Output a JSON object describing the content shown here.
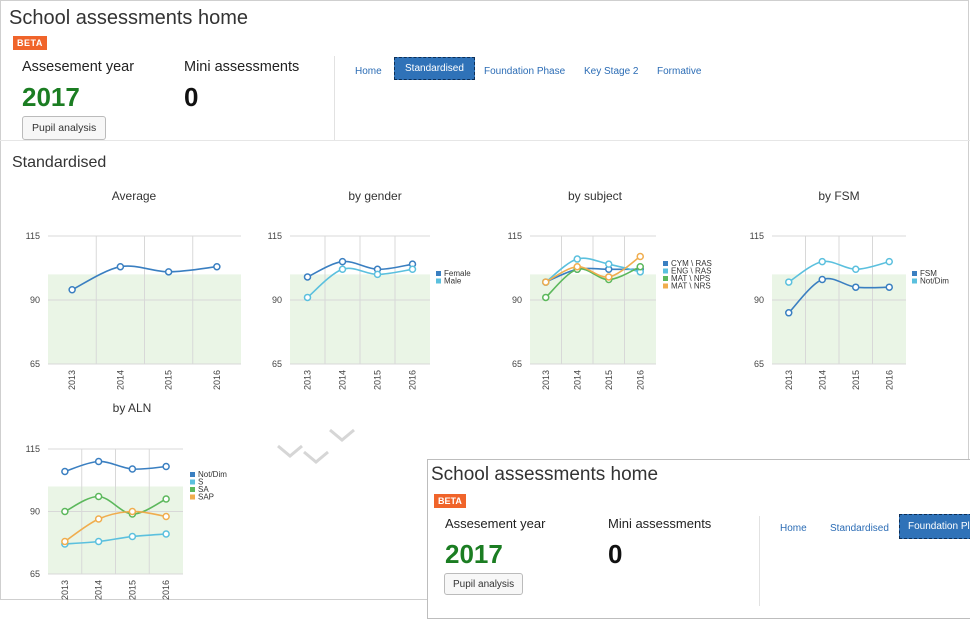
{
  "app": {
    "title": "School assessments home",
    "beta": "BETA"
  },
  "stats": {
    "year_label": "Assesement year",
    "year_value": "2017",
    "mini_label": "Mini assessments",
    "mini_value": "0",
    "pupil_button": "Pupil analysis"
  },
  "tabs": [
    {
      "label": "Home",
      "active": false
    },
    {
      "label": "Standardised",
      "active": true
    },
    {
      "label": "Foundation Phase",
      "active": false
    },
    {
      "label": "Key Stage 2",
      "active": false
    },
    {
      "label": "Formative",
      "active": false
    }
  ],
  "section_title": "Standardised",
  "colors": {
    "blue": "#3a7fc1",
    "cyan": "#5bc0de",
    "green": "#5cb85c",
    "orange": "#f0ad4e",
    "band": "#eaf5e6",
    "year_green": "#1b7d22",
    "beta": "#f0642a",
    "accent": "#2f72b8"
  },
  "chart_data": [
    {
      "type": "line",
      "title": "Average",
      "x": [
        "2013",
        "2014",
        "2015",
        "2016"
      ],
      "ylim": [
        65,
        115
      ],
      "yticks": [
        65,
        90,
        115
      ],
      "band": [
        65,
        100
      ],
      "series": [
        {
          "color": "#3a7fc1",
          "values": [
            94,
            103,
            101,
            103
          ]
        }
      ]
    },
    {
      "type": "line",
      "title": "by gender",
      "x": [
        "2013",
        "2014",
        "2015",
        "2016"
      ],
      "ylim": [
        65,
        115
      ],
      "yticks": [
        65,
        90,
        115
      ],
      "band": [
        65,
        100
      ],
      "series": [
        {
          "name": "Female",
          "color": "#3a7fc1",
          "values": [
            99,
            105,
            102,
            104
          ]
        },
        {
          "name": "Male",
          "color": "#5bc0de",
          "values": [
            91,
            102,
            100,
            102
          ]
        }
      ]
    },
    {
      "type": "line",
      "title": "by subject",
      "x": [
        "2013",
        "2014",
        "2015",
        "2016"
      ],
      "ylim": [
        65,
        115
      ],
      "yticks": [
        65,
        90,
        115
      ],
      "band": [
        65,
        100
      ],
      "series": [
        {
          "name": "CYM \\ RAS",
          "color": "#3a7fc1",
          "values": [
            97,
            102,
            102,
            102
          ]
        },
        {
          "name": "ENG \\ RAS",
          "color": "#5bc0de",
          "values": [
            97,
            106,
            104,
            101
          ]
        },
        {
          "name": "MAT \\ NPS",
          "color": "#5cb85c",
          "values": [
            91,
            102,
            98,
            103
          ]
        },
        {
          "name": "MAT \\ NRS",
          "color": "#f0ad4e",
          "values": [
            97,
            103,
            99,
            107
          ]
        }
      ]
    },
    {
      "type": "line",
      "title": "by FSM",
      "x": [
        "2013",
        "2014",
        "2015",
        "2016"
      ],
      "ylim": [
        65,
        115
      ],
      "yticks": [
        65,
        90,
        115
      ],
      "band": [
        65,
        100
      ],
      "series": [
        {
          "name": "FSM",
          "color": "#3a7fc1",
          "values": [
            85,
            98,
            95,
            95
          ]
        },
        {
          "name": "Not/Dim",
          "color": "#5bc0de",
          "values": [
            97,
            105,
            102,
            105
          ]
        }
      ]
    },
    {
      "type": "line",
      "title": "by ALN",
      "x": [
        "2013",
        "2014",
        "2015",
        "2016"
      ],
      "ylim": [
        65,
        115
      ],
      "yticks": [
        65,
        90,
        115
      ],
      "band": [
        65,
        100
      ],
      "series": [
        {
          "name": "Not/Dim",
          "color": "#3a7fc1",
          "values": [
            106,
            110,
            107,
            108
          ]
        },
        {
          "name": "S",
          "color": "#5bc0de",
          "values": [
            77,
            78,
            80,
            81
          ]
        },
        {
          "name": "SA",
          "color": "#5cb85c",
          "values": [
            90,
            96,
            89,
            95
          ]
        },
        {
          "name": "SAP",
          "color": "#f0ad4e",
          "values": [
            78,
            87,
            90,
            88
          ]
        }
      ]
    }
  ],
  "overlay": {
    "title": "School assessments home",
    "beta": "BETA",
    "year_label": "Assesement year",
    "year_value": "2017",
    "mini_label": "Mini assessments",
    "mini_value": "0",
    "pupil_button": "Pupil analysis",
    "tabs": [
      {
        "label": "Home",
        "active": false
      },
      {
        "label": "Standardised",
        "active": false
      },
      {
        "label": "Foundation Pl",
        "active": true
      }
    ]
  }
}
